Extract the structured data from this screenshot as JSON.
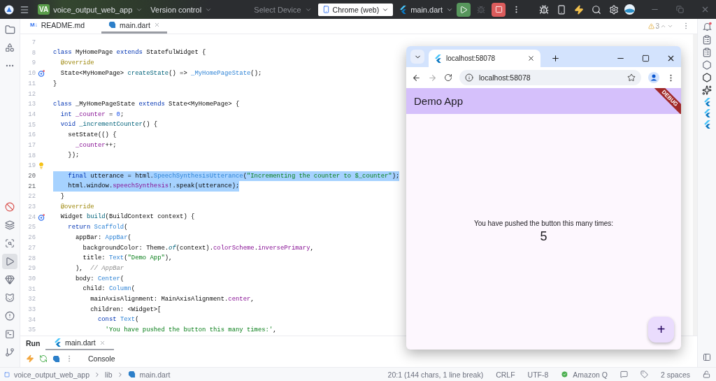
{
  "top_bar": {
    "project_badge": "VA",
    "project": "voice_output_web_app",
    "version_control": "Version control",
    "device_placeholder": "Select Device",
    "device": "Chrome (web)",
    "run_config": "main.dart"
  },
  "editor_tabs": [
    {
      "kind": "markdown",
      "icon_text": "M↓",
      "label": "README.md",
      "selected": false
    },
    {
      "kind": "dart",
      "label": "main.dart",
      "selected": true
    }
  ],
  "warnings": {
    "count": "3"
  },
  "code_lines": [
    {
      "number": "7",
      "selected": false
    },
    {
      "number": "8",
      "selected": false,
      "tokens": [
        {
          "kind": "kw",
          "text": "class"
        },
        {
          "kind": "plain",
          "text": " MyHomePage "
        },
        {
          "kind": "kw",
          "text": "extends"
        },
        {
          "kind": "plain",
          "text": " StatefulWidget {"
        }
      ]
    },
    {
      "number": "9",
      "selected": false,
      "tokens": [
        {
          "kind": "annotation",
          "text": "  @override"
        }
      ]
    },
    {
      "number": "10",
      "gutter": {
        "kind": "override"
      },
      "selected": false,
      "tokens": [
        {
          "kind": "plain",
          "text": "  State<MyHomePage> "
        },
        {
          "kind": "decl",
          "text": "createState"
        },
        {
          "kind": "plain",
          "text": "() => "
        },
        {
          "kind": "call",
          "text": "_MyHomePageState"
        },
        {
          "kind": "plain",
          "text": "();"
        }
      ]
    },
    {
      "number": "11",
      "selected": false,
      "tokens": [
        {
          "kind": "plain",
          "text": "}"
        }
      ]
    },
    {
      "number": "12",
      "selected": false
    },
    {
      "number": "13",
      "selected": false,
      "tokens": [
        {
          "kind": "kw",
          "text": "class"
        },
        {
          "kind": "plain",
          "text": " _MyHomePageState "
        },
        {
          "kind": "kw",
          "text": "extends"
        },
        {
          "kind": "plain",
          "text": " State<MyHomePage> {"
        }
      ]
    },
    {
      "number": "14",
      "selected": false,
      "tokens": [
        {
          "kind": "kw",
          "text": "  int "
        },
        {
          "kind": "field",
          "text": "_counter"
        },
        {
          "kind": "plain",
          "text": " = "
        },
        {
          "kind": "number",
          "text": "0"
        },
        {
          "kind": "plain",
          "text": ";"
        }
      ]
    },
    {
      "number": "15",
      "selected": false,
      "tokens": [
        {
          "kind": "kw",
          "text": "  void "
        },
        {
          "kind": "decl",
          "text": "_incrementCounter"
        },
        {
          "kind": "plain",
          "text": "() {"
        }
      ]
    },
    {
      "number": "16",
      "selected": false,
      "tokens": [
        {
          "kind": "plain",
          "text": "    setState(() {"
        }
      ]
    },
    {
      "number": "17",
      "selected": false,
      "tokens": [
        {
          "kind": "field",
          "text": "      _counter"
        },
        {
          "kind": "plain",
          "text": "++;"
        }
      ]
    },
    {
      "number": "18",
      "selected": false,
      "tokens": [
        {
          "kind": "plain",
          "text": "    });"
        }
      ]
    },
    {
      "number": "19",
      "gutter": {
        "kind": "bulb"
      },
      "selected": false
    },
    {
      "number": "20",
      "selected": true,
      "tokens": [
        {
          "kind": "kw",
          "text": "    final"
        },
        {
          "kind": "plain",
          "text": " utterance = html."
        },
        {
          "kind": "call",
          "text": "SpeechSynthesisUtterance"
        },
        {
          "kind": "plain",
          "text": "("
        },
        {
          "kind": "string",
          "text": "\"Incrementing the counter to $_counter\""
        },
        {
          "kind": "plain",
          "text": ");"
        }
      ]
    },
    {
      "number": "21",
      "selected": true,
      "tokens": [
        {
          "kind": "plain",
          "text": "    html.window."
        },
        {
          "kind": "field",
          "text": "speechSynthesis"
        },
        {
          "kind": "plain",
          "text": "!.speak(utterance);"
        }
      ]
    },
    {
      "number": "22",
      "selected": false,
      "tokens": [
        {
          "kind": "plain",
          "text": "  }"
        }
      ]
    },
    {
      "number": "23",
      "selected": false,
      "tokens": [
        {
          "kind": "annotation",
          "text": "  @override"
        }
      ]
    },
    {
      "number": "24",
      "gutter": {
        "kind": "override"
      },
      "selected": false,
      "tokens": [
        {
          "kind": "plain",
          "text": "  Widget "
        },
        {
          "kind": "decl",
          "text": "build"
        },
        {
          "kind": "plain",
          "text": "(BuildContext context) {"
        }
      ]
    },
    {
      "number": "25",
      "selected": false,
      "tokens": [
        {
          "kind": "kw",
          "text": "    return "
        },
        {
          "kind": "call",
          "text": "Scaffold"
        },
        {
          "kind": "plain",
          "text": "("
        }
      ]
    },
    {
      "number": "26",
      "selected": false,
      "tokens": [
        {
          "kind": "plain",
          "text": "      appBar: "
        },
        {
          "kind": "call",
          "text": "AppBar"
        },
        {
          "kind": "plain",
          "text": "("
        }
      ]
    },
    {
      "number": "27",
      "selected": false,
      "tokens": [
        {
          "kind": "plain",
          "text": "        backgroundColor: Theme."
        },
        {
          "kind": "static",
          "text": "of"
        },
        {
          "kind": "plain",
          "text": "(context)."
        },
        {
          "kind": "field",
          "text": "colorScheme"
        },
        {
          "kind": "plain",
          "text": "."
        },
        {
          "kind": "field",
          "text": "inversePrimary"
        },
        {
          "kind": "plain",
          "text": ","
        }
      ]
    },
    {
      "number": "28",
      "selected": false,
      "tokens": [
        {
          "kind": "plain",
          "text": "        title: "
        },
        {
          "kind": "call",
          "text": "Text"
        },
        {
          "kind": "plain",
          "text": "("
        },
        {
          "kind": "string",
          "text": "\"Demo App\""
        },
        {
          "kind": "plain",
          "text": "),"
        }
      ]
    },
    {
      "number": "29",
      "selected": false,
      "tokens": [
        {
          "kind": "plain",
          "text": "      ),  "
        },
        {
          "kind": "comment",
          "text": "// AppBar"
        }
      ]
    },
    {
      "number": "30",
      "selected": false,
      "tokens": [
        {
          "kind": "plain",
          "text": "      body: "
        },
        {
          "kind": "call",
          "text": "Center"
        },
        {
          "kind": "plain",
          "text": "("
        }
      ]
    },
    {
      "number": "31",
      "selected": false,
      "tokens": [
        {
          "kind": "plain",
          "text": "        child: "
        },
        {
          "kind": "call",
          "text": "Column"
        },
        {
          "kind": "plain",
          "text": "("
        }
      ]
    },
    {
      "number": "32",
      "selected": false,
      "tokens": [
        {
          "kind": "plain",
          "text": "          mainAxisAlignment: MainAxisAlignment."
        },
        {
          "kind": "field",
          "text": "center"
        },
        {
          "kind": "plain",
          "text": ","
        }
      ]
    },
    {
      "number": "33",
      "selected": false,
      "tokens": [
        {
          "kind": "plain",
          "text": "          children: <Widget>["
        }
      ]
    },
    {
      "number": "34",
      "selected": false,
      "tokens": [
        {
          "kind": "kw",
          "text": "            const "
        },
        {
          "kind": "call",
          "text": "Text"
        },
        {
          "kind": "plain",
          "text": "("
        }
      ]
    },
    {
      "number": "35",
      "selected": false,
      "tokens": [
        {
          "kind": "string",
          "text": "              'You have pushed the button this many times:'"
        },
        {
          "kind": "plain",
          "text": ","
        }
      ]
    }
  ],
  "left_toolbar": {
    "top": [
      {
        "selected": false
      },
      {
        "selected": false
      },
      {
        "selected": false
      }
    ],
    "bottom": [
      {
        "selected": false
      },
      {
        "selected": false
      },
      {
        "selected": false
      },
      {
        "selected": true
      },
      {
        "selected": false
      },
      {
        "selected": false
      },
      {
        "selected": false
      },
      {
        "selected": false
      },
      {
        "selected": false
      }
    ]
  },
  "browser": {
    "tab_title": "localhost:58078",
    "address": "localhost:58078",
    "app_title": "Demo App",
    "banner": "DEBUG",
    "message": "You have pushed the button this many times:",
    "count": "5",
    "fab": "+"
  },
  "run_panel": {
    "title": "Run",
    "tabs": [
      {
        "label": "main.dart",
        "selected": true
      }
    ],
    "console": "Console"
  },
  "status_bar": {
    "breadcrumbs": [
      "voice_output_web_app",
      "lib",
      "main.dart"
    ],
    "position": "20:1 (144 chars, 1 line break)",
    "line_ending": "CRLF",
    "encoding": "UTF-8",
    "plugin": "Amazon Q",
    "indent": "2 spaces"
  }
}
